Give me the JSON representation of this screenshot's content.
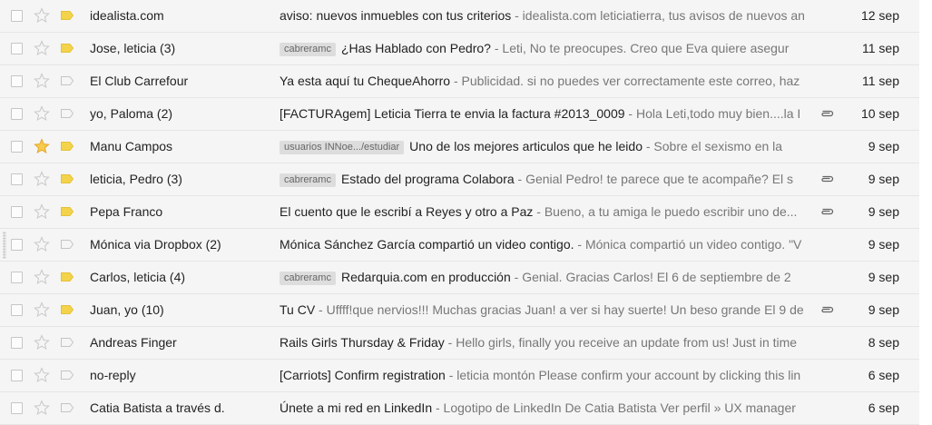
{
  "inbox": {
    "rows": [
      {
        "sender": "idealista.com",
        "label": "",
        "subject": "aviso: nuevos inmuebles con tus criterios",
        "snippet": " - idealista.com leticiatierra, tus avisos de nuevos an",
        "date": "12 sep",
        "starred": false,
        "important": true,
        "attachment": false
      },
      {
        "sender": "Jose, leticia (3)",
        "label": "cabreramc",
        "subject": "¿Has Hablado con Pedro?",
        "snippet": " - Leti, No te preocupes. Creo que Eva quiere asegur",
        "date": "11 sep",
        "starred": false,
        "important": true,
        "attachment": false
      },
      {
        "sender": "El Club Carrefour",
        "label": "",
        "subject": "Ya esta aquí tu ChequeAhorro",
        "snippet": " - Publicidad. si no puedes ver correctamente este correo, haz",
        "date": "11 sep",
        "starred": false,
        "important": false,
        "attachment": false
      },
      {
        "sender": "yo, Paloma (2)",
        "label": "",
        "subject": "[FACTURAgem] Leticia Tierra te envia la factura #2013_0009",
        "snippet": " - Hola Leti,todo muy bien....la I",
        "date": "10 sep",
        "starred": false,
        "important": false,
        "attachment": true
      },
      {
        "sender": "Manu Campos",
        "label": "usuarios INNoe.../estudiar",
        "subject": "Uno de los mejores articulos que he leido",
        "snippet": " - Sobre el sexismo en la",
        "date": "9 sep",
        "starred": true,
        "important": true,
        "attachment": false
      },
      {
        "sender": "leticia, Pedro (3)",
        "label": "cabreramc",
        "subject": "Estado del programa Colabora",
        "snippet": " - Genial Pedro! te parece que te acompañe? El s",
        "date": "9 sep",
        "starred": false,
        "important": true,
        "attachment": true
      },
      {
        "sender": "Pepa Franco",
        "label": "",
        "subject": "El cuento que le escribí a Reyes y otro a Paz",
        "snippet": " - Bueno, a tu amiga le puedo escribir uno de...",
        "date": "9 sep",
        "starred": false,
        "important": true,
        "attachment": true
      },
      {
        "sender": "Mónica via Dropbox (2)",
        "label": "",
        "subject": "Mónica Sánchez García compartió un video contigo.",
        "snippet": " - Mónica compartió un video contigo. \"V",
        "date": "9 sep",
        "starred": false,
        "important": false,
        "attachment": false
      },
      {
        "sender": "Carlos, leticia (4)",
        "label": "cabreramc",
        "subject": "Redarquia.com en producción",
        "snippet": " - Genial. Gracias Carlos! El 6 de septiembre de 2",
        "date": "9 sep",
        "starred": false,
        "important": true,
        "attachment": false
      },
      {
        "sender": "Juan, yo (10)",
        "label": "",
        "subject": "Tu CV",
        "snippet": " - Uffff!que nervios!!! Muchas gracias Juan! a ver si hay suerte! Un beso grande El 9 de",
        "date": "9 sep",
        "starred": false,
        "important": true,
        "attachment": true
      },
      {
        "sender": "Andreas Finger",
        "label": "",
        "subject": "Rails Girls Thursday & Friday",
        "snippet": " - Hello girls, finally you receive an update from us! Just in time",
        "date": "8 sep",
        "starred": false,
        "important": false,
        "attachment": false
      },
      {
        "sender": "no-reply",
        "label": "",
        "subject": "[Carriots] Confirm registration",
        "snippet": " - leticia montón Please confirm your account by clicking this lin",
        "date": "6 sep",
        "starred": false,
        "important": false,
        "attachment": false
      },
      {
        "sender": "Catia Batista a través d.",
        "label": "",
        "subject": "Únete a mi red en LinkedIn",
        "snippet": " - Logotipo de LinkedIn De Catia Batista Ver perfil » UX manager",
        "date": "6 sep",
        "starred": false,
        "important": false,
        "attachment": false
      }
    ]
  },
  "colors": {
    "star_on": "#f7cb4d",
    "star_off": "#c8c8c8",
    "important_on": "#f3d34a",
    "important_off": "#c4c4c4",
    "row_bg": "#f5f5f5",
    "label_bg": "#dddddd"
  },
  "icons": {
    "checkbox": "checkbox-icon",
    "star": "star-icon",
    "importance": "importance-marker-icon",
    "attachment": "paperclip-icon"
  }
}
